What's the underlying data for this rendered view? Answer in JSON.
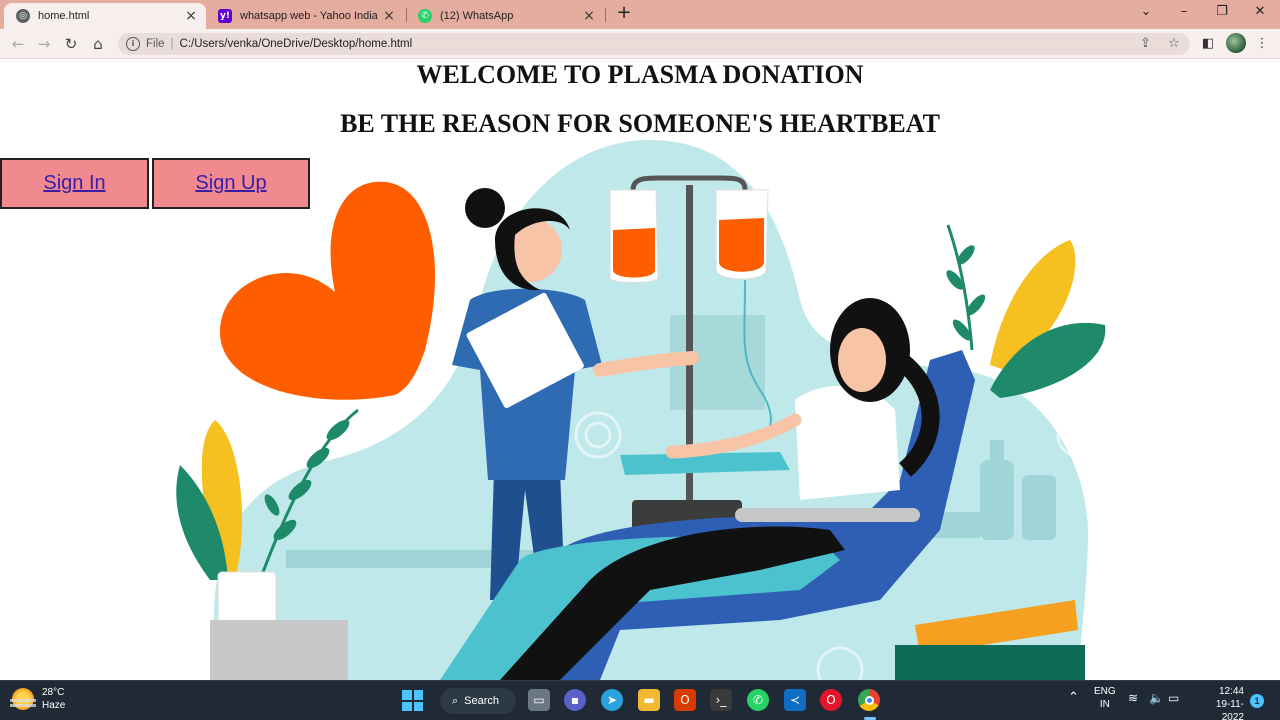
{
  "browser": {
    "tabs": [
      {
        "title": "home.html",
        "favicon": "globe-icon",
        "color": "#5f6368"
      },
      {
        "title": "whatsapp web - Yahoo India Sear",
        "favicon": "yahoo-icon",
        "color": "#6001d2"
      },
      {
        "title": "(12) WhatsApp",
        "favicon": "whatsapp-icon",
        "color": "#25d366"
      }
    ],
    "address": {
      "scheme": "File",
      "url": "C:/Users/venka/OneDrive/Desktop/home.html"
    }
  },
  "page": {
    "heading": "WELCOME TO PLASMA DONATION",
    "subheading": "BE THE REASON FOR SOMEONE'S HEARTBEAT",
    "signin_label": "Sign In",
    "signup_label": "Sign Up",
    "button_color": "#f08a8f",
    "link_color": "#3a1ea8"
  },
  "taskbar": {
    "weather": {
      "temp": "28°C",
      "condition": "Haze"
    },
    "search_label": "Search",
    "language": {
      "code": "ENG",
      "region": "IN"
    },
    "clock": {
      "time": "12:44",
      "date": "19-11-2022"
    },
    "notifications": "1"
  }
}
